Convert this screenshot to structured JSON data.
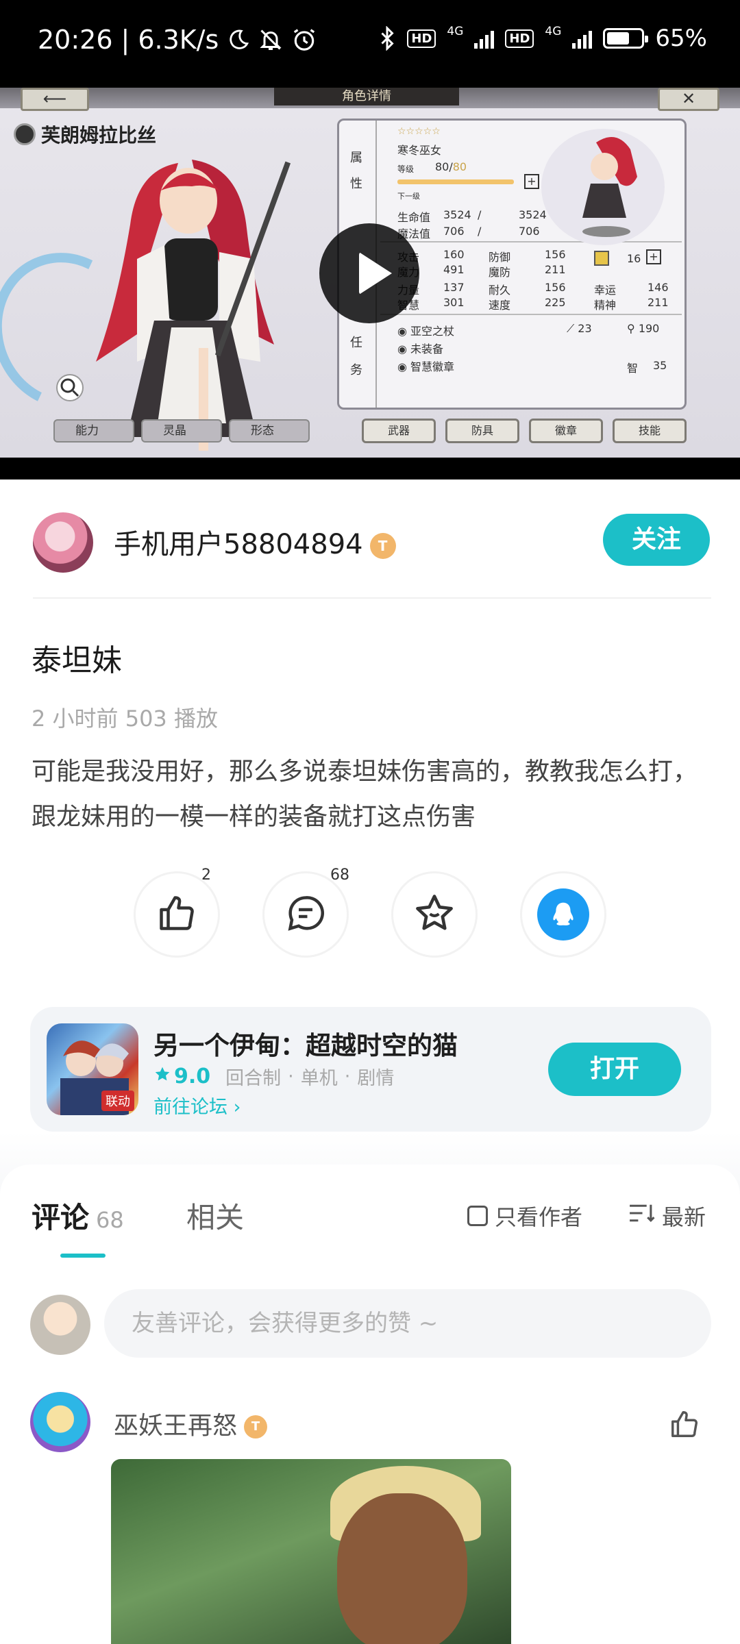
{
  "status_bar": {
    "time": "20:26",
    "speed": "6.3K/s",
    "network_1": "4G",
    "network_2": "4G",
    "hd_1": "HD",
    "hd_2": "HD",
    "battery": "65%",
    "battery_level": 0.65
  },
  "video": {
    "top_title": "角色详情",
    "character_name": "芙朗姆拉比丝",
    "class_name": "寒冬巫女",
    "level_label": "等级",
    "level_value": "80/",
    "level_max": "80",
    "next_level_label": "下一级",
    "side_attr_1": "属",
    "side_attr_2": "性",
    "side_task_1": "任",
    "side_task_2": "务",
    "hp_label": "生命值",
    "hp_value": "3524",
    "hp_max": "3524",
    "mp_label": "魔法值",
    "mp_value": "706",
    "mp_max": "706",
    "stats_left": [
      {
        "label": "攻击",
        "value": "160"
      },
      {
        "label": "魔力",
        "value": "491"
      },
      {
        "label": "力量",
        "value": "137"
      },
      {
        "label": "智慧",
        "value": "301"
      }
    ],
    "stats_mid": [
      {
        "label": "防御",
        "value": "156"
      },
      {
        "label": "魔防",
        "value": "211"
      },
      {
        "label": "耐久",
        "value": "156"
      },
      {
        "label": "速度",
        "value": "225"
      }
    ],
    "stats_right": [
      {
        "label": "",
        "value": "16"
      },
      {
        "label": "幸运",
        "value": "146"
      },
      {
        "label": "精神",
        "value": "211"
      }
    ],
    "equip_1": "亚空之杖",
    "equip_1_v1": "23",
    "equip_1_v2": "190",
    "equip_2": "未装备",
    "equip_3": "智慧徽章",
    "equip_3_tag": "智",
    "equip_3_value": "35",
    "bottom_tabs": [
      "武器",
      "防具",
      "徽章",
      "技能"
    ],
    "left_tabs": [
      "能力",
      "灵晶",
      "形态"
    ]
  },
  "author": {
    "name": "手机用户58804894",
    "badge": "T",
    "follow_label": "关注"
  },
  "post": {
    "title": "泰坦妹",
    "meta": "2 小时前   503 播放",
    "body": "可能是我没用好，那么多说泰坦妹伤害高的，教教我怎么打，跟龙妹用的一模一样的装备就打这点伤害"
  },
  "actions": {
    "like_count": "2",
    "comment_count": "68"
  },
  "game": {
    "name": "另一个伊甸：超越时空的猫",
    "rating": "9.0",
    "tags": [
      "回合制",
      "单机",
      "剧情"
    ],
    "forum_link": "前往论坛 ›",
    "open_label": "打开",
    "icon_tag": "联动"
  },
  "comments": {
    "tab_label": "评论",
    "tab_count": "68",
    "related_label": "相关",
    "author_only_label": "只看作者",
    "sort_label": "最新",
    "input_placeholder": "友善评论，会获得更多的赞 ~",
    "first_comment_author": "巫妖王再怒",
    "first_comment_badge": "T"
  },
  "colors": {
    "accent": "#1cbfc8",
    "qq": "#1c9cf3",
    "badge": "#f2b66a"
  }
}
